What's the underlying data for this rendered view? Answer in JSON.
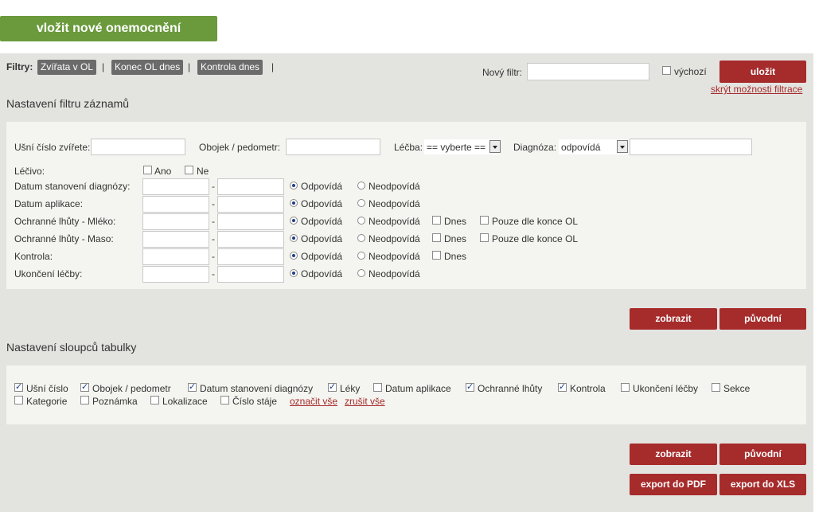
{
  "header": {
    "add_button_label": "vložit nové onemocnění"
  },
  "filters": {
    "label": "Filtry:",
    "chips": [
      "Zvířata v OL",
      "Konec OL dnes",
      "Kontrola dnes"
    ],
    "separator": "|",
    "new_filter_label": "Nový filtr:",
    "new_filter_value": "",
    "default_label": "výchozí",
    "save_label": "uložit",
    "hide_options_link": "skrýt možnosti filtrace"
  },
  "filter_section": {
    "title": "Nastavení filtru záznamů",
    "ear_number_label": "Ušní číslo zvířete:",
    "collar_label": "Obojek / pedometr:",
    "treatment_label": "Léčba:",
    "treatment_value": "== vyberte ==",
    "diagnosis_label": "Diagnóza:",
    "diagnosis_value": "odpovídá",
    "medicine_label": "Léčivo:",
    "yes_label": "Ano",
    "no_label": "Ne",
    "dash": "-",
    "match_label": "Odpovídá",
    "nomatch_label": "Neodpovídá",
    "today_label": "Dnes",
    "end_ol_label": "Pouze dle konce OL",
    "rows": [
      {
        "label": "Datum stanovení diagnózy:"
      },
      {
        "label": "Datum aplikace:"
      },
      {
        "label": "Ochranné lhůty - Mléko:"
      },
      {
        "label": "Ochranné lhůty - Maso:"
      },
      {
        "label": "Kontrola:"
      },
      {
        "label": "Ukončení léčby:"
      }
    ],
    "show_label": "zobrazit",
    "original_label": "původní"
  },
  "columns_section": {
    "title": "Nastavení sloupců tabulky",
    "items": [
      {
        "label": "Ušní číslo",
        "checked": true
      },
      {
        "label": "Obojek / pedometr",
        "checked": true
      },
      {
        "label": "Datum stanovení diagnózy",
        "checked": true
      },
      {
        "label": "Léky",
        "checked": true
      },
      {
        "label": "Datum aplikace",
        "checked": false
      },
      {
        "label": "Ochranné lhůty",
        "checked": true
      },
      {
        "label": "Kontrola",
        "checked": true
      },
      {
        "label": "Ukončení léčby",
        "checked": false
      },
      {
        "label": "Sekce",
        "checked": false
      },
      {
        "label": "Kategorie",
        "checked": false
      },
      {
        "label": "Poznámka",
        "checked": false
      },
      {
        "label": "Lokalizace",
        "checked": false
      },
      {
        "label": "Číslo stáje",
        "checked": false
      }
    ],
    "select_all_link": "označit vše",
    "cancel_all_link": "zrušit vše",
    "show_label": "zobrazit",
    "original_label": "původní",
    "export_pdf_label": "export do PDF",
    "export_xls_label": "export do XLS"
  }
}
